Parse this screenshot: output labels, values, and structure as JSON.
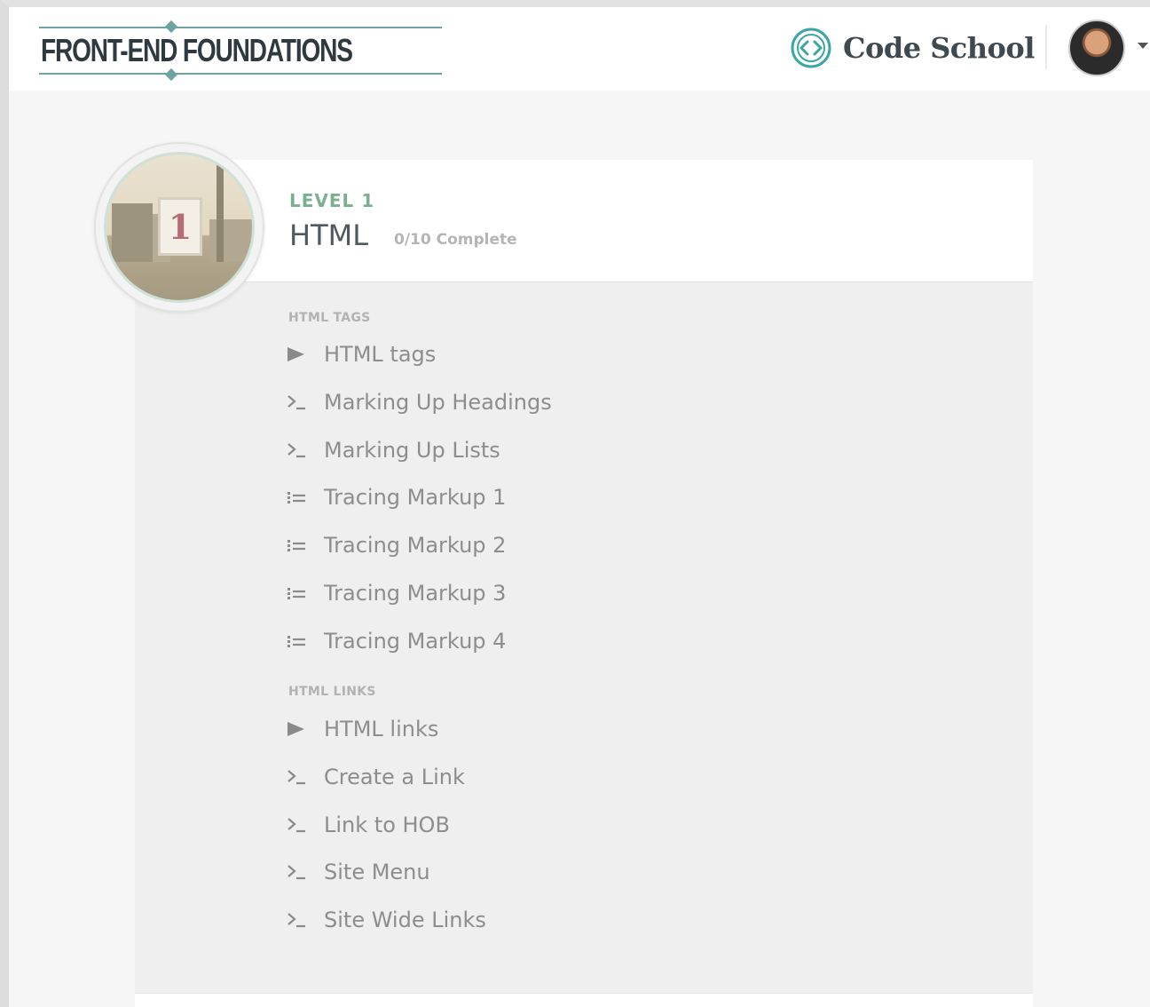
{
  "header": {
    "brand": "FRONT-END FOUNDATIONS",
    "logo_text": "Code School",
    "accent": "#3aa6a6"
  },
  "level": {
    "label": "LEVEL 1",
    "title": "HTML",
    "progress": "0/10 Complete",
    "badge_number": "1",
    "accent": "#7bb08e"
  },
  "sections": [
    {
      "title": "HTML TAGS",
      "lessons": [
        {
          "label": "HTML tags",
          "icon": "play-icon"
        },
        {
          "label": "Marking Up Headings",
          "icon": "terminal-icon"
        },
        {
          "label": "Marking Up Lists",
          "icon": "terminal-icon"
        },
        {
          "label": "Tracing Markup 1",
          "icon": "list-icon"
        },
        {
          "label": "Tracing Markup 2",
          "icon": "list-icon"
        },
        {
          "label": "Tracing Markup 3",
          "icon": "list-icon"
        },
        {
          "label": "Tracing Markup 4",
          "icon": "list-icon"
        }
      ]
    },
    {
      "title": "HTML LINKS",
      "lessons": [
        {
          "label": "HTML links",
          "icon": "play-icon"
        },
        {
          "label": "Create a Link",
          "icon": "terminal-icon"
        },
        {
          "label": "Link to HOB",
          "icon": "terminal-icon"
        },
        {
          "label": "Site Menu",
          "icon": "terminal-icon"
        },
        {
          "label": "Site Wide Links",
          "icon": "terminal-icon"
        }
      ]
    }
  ]
}
